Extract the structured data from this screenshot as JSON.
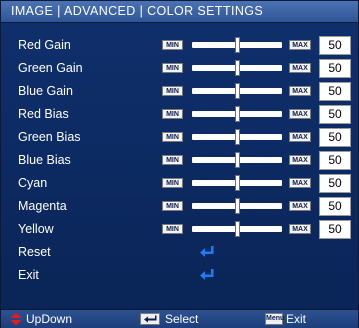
{
  "header": {
    "title": "IMAGE | ADVANCED | COLOR SETTINGS"
  },
  "slider_rows": [
    {
      "label": "Red Gain",
      "min_label": "MIN",
      "max_label": "MAX",
      "value": "50",
      "fraction": 0.5
    },
    {
      "label": "Green Gain",
      "min_label": "MIN",
      "max_label": "MAX",
      "value": "50",
      "fraction": 0.5
    },
    {
      "label": "Blue Gain",
      "min_label": "MIN",
      "max_label": "MAX",
      "value": "50",
      "fraction": 0.5
    },
    {
      "label": "Red Bias",
      "min_label": "MIN",
      "max_label": "MAX",
      "value": "50",
      "fraction": 0.5
    },
    {
      "label": "Green Bias",
      "min_label": "MIN",
      "max_label": "MAX",
      "value": "50",
      "fraction": 0.5
    },
    {
      "label": "Blue Bias",
      "min_label": "MIN",
      "max_label": "MAX",
      "value": "50",
      "fraction": 0.5
    },
    {
      "label": "Cyan",
      "min_label": "MIN",
      "max_label": "MAX",
      "value": "50",
      "fraction": 0.5
    },
    {
      "label": "Magenta",
      "min_label": "MIN",
      "max_label": "MAX",
      "value": "50",
      "fraction": 0.5
    },
    {
      "label": "Yellow",
      "min_label": "MIN",
      "max_label": "MAX",
      "value": "50",
      "fraction": 0.5
    }
  ],
  "action_rows": [
    {
      "label": "Reset",
      "icon": "enter-arrow-icon"
    },
    {
      "label": "Exit",
      "icon": "enter-arrow-icon"
    }
  ],
  "footer": {
    "updown_label": "UpDown",
    "select_label": "Select",
    "menu_key_label": "Menu",
    "exit_label": "Exit"
  },
  "colors": {
    "panel_background": "#0c2a62",
    "header_background": "#3d64a5",
    "accent_red": "#e11b22",
    "enter_icon_blue": "#1e7cf2"
  }
}
